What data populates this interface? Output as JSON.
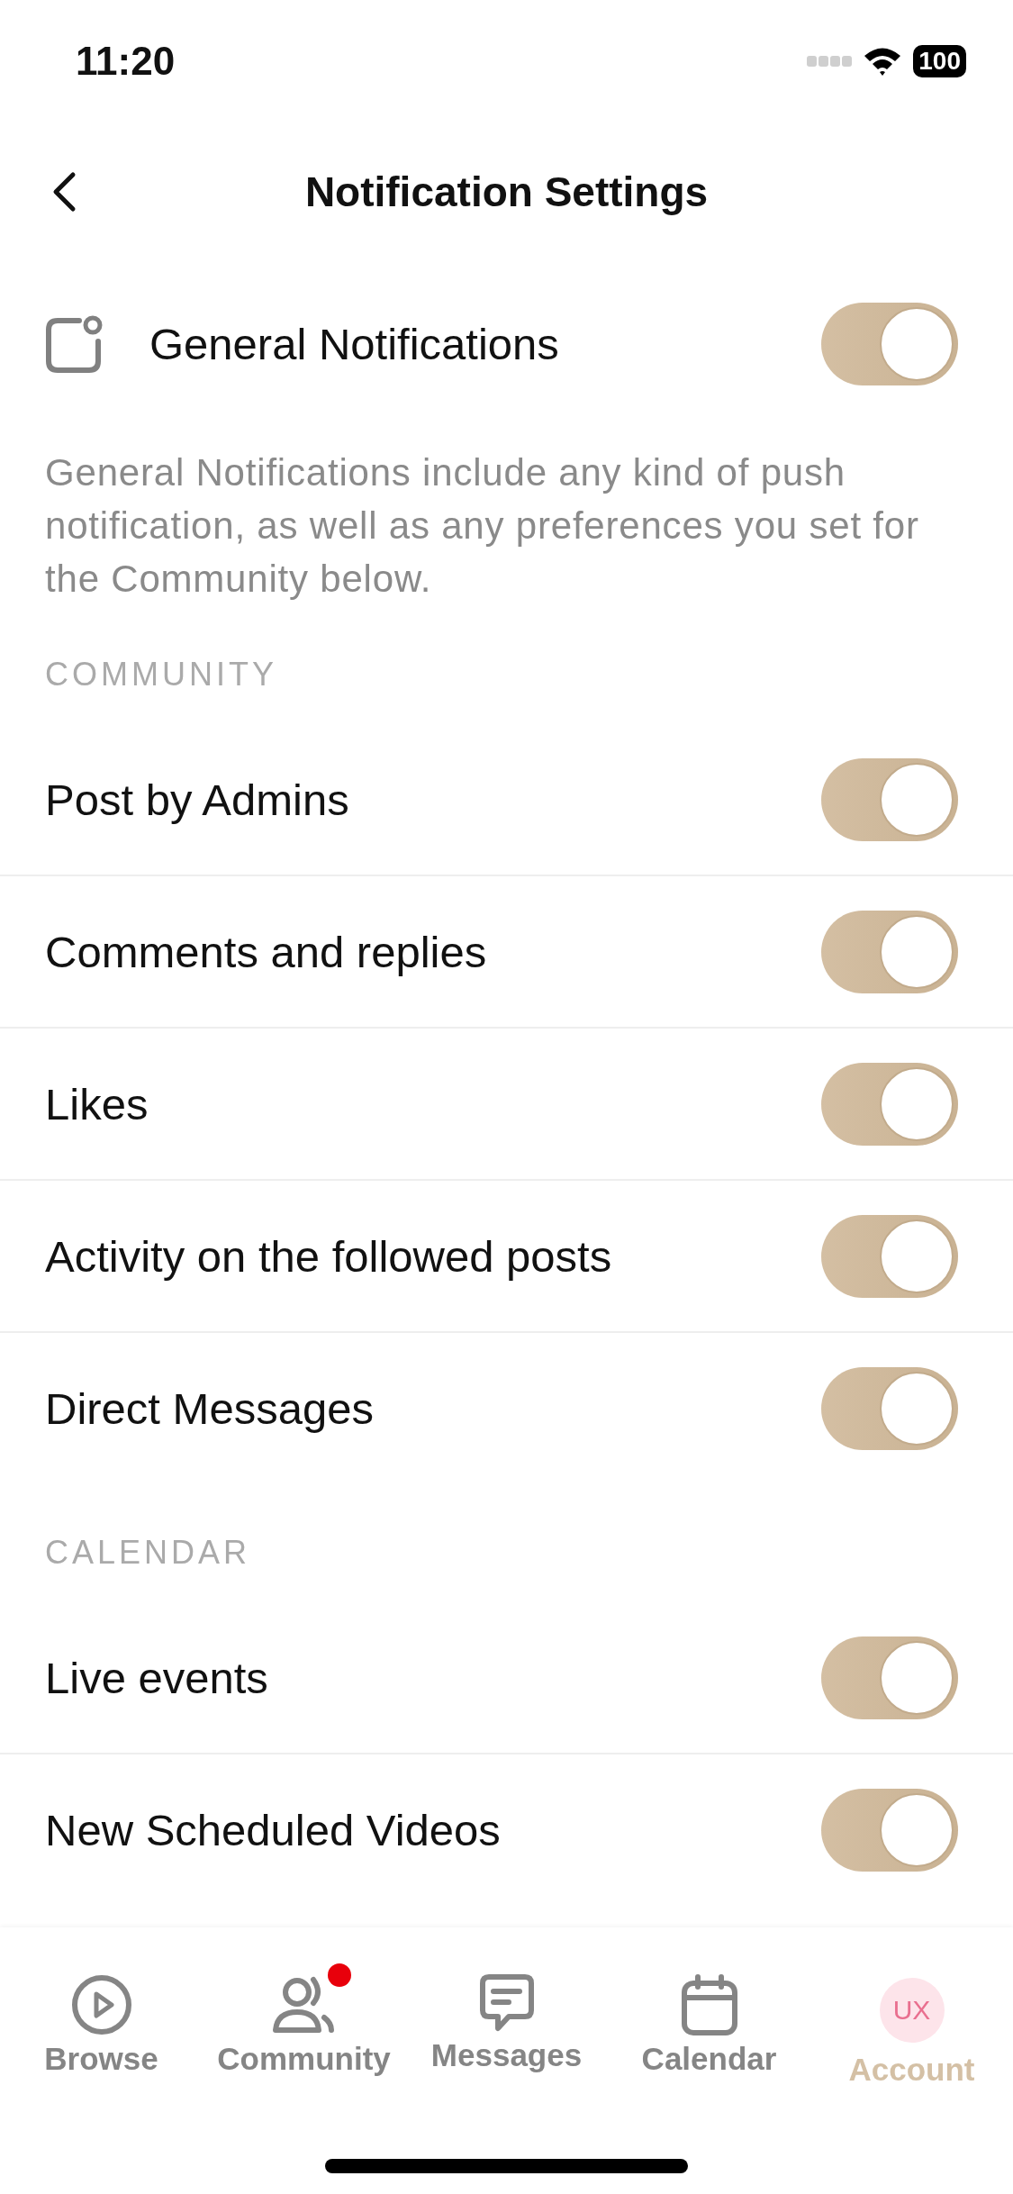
{
  "status_bar": {
    "time": "11:20",
    "battery": "100"
  },
  "header": {
    "title": "Notification Settings"
  },
  "general": {
    "label": "General Notifications",
    "on": true,
    "description": "General Notifications include any kind of push notification, as well as any preferences you set for the Community below."
  },
  "sections": [
    {
      "title": "COMMUNITY",
      "items": [
        {
          "label": "Post by Admins",
          "on": true
        },
        {
          "label": "Comments and replies",
          "on": true
        },
        {
          "label": "Likes",
          "on": true
        },
        {
          "label": "Activity on the followed posts",
          "on": true
        },
        {
          "label": "Direct Messages",
          "on": true
        }
      ]
    },
    {
      "title": "CALENDAR",
      "items": [
        {
          "label": "Live events",
          "on": true
        },
        {
          "label": "New Scheduled Videos",
          "on": true
        }
      ]
    }
  ],
  "tab_bar": [
    {
      "kind": "browse",
      "label": "Browse",
      "selected": false,
      "badge": false
    },
    {
      "kind": "community",
      "label": "Community",
      "selected": false,
      "badge": true
    },
    {
      "kind": "messages",
      "label": "Messages",
      "selected": false,
      "badge": false
    },
    {
      "kind": "calendar",
      "label": "Calendar",
      "selected": false,
      "badge": false
    },
    {
      "kind": "account",
      "label": "Account",
      "selected": true,
      "badge": false,
      "initials": "UX"
    }
  ]
}
